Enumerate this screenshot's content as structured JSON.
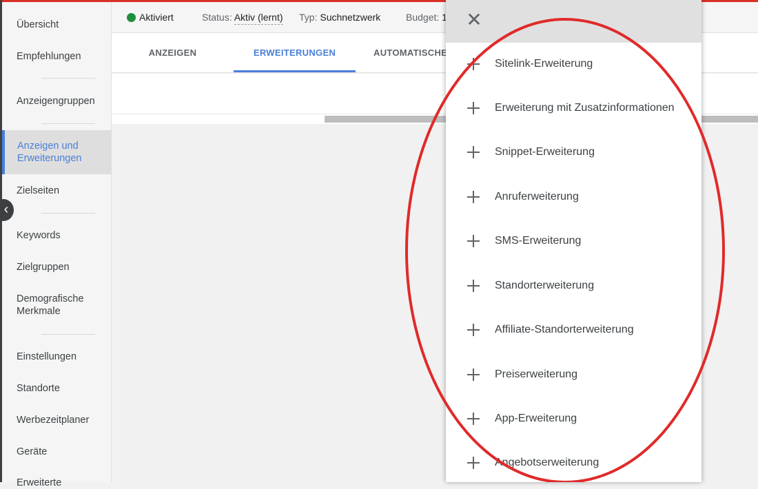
{
  "sidebar": {
    "items": [
      {
        "label": "Übersicht"
      },
      {
        "label": "Empfehlungen"
      },
      {
        "label": "Anzeigengruppen"
      },
      {
        "label": "Anzeigen und Erweiterungen"
      },
      {
        "label": "Zielseiten"
      },
      {
        "label": "Keywords"
      },
      {
        "label": "Zielgruppen"
      },
      {
        "label": "Demografische Merkmale"
      },
      {
        "label": "Einstellungen"
      },
      {
        "label": "Standorte"
      },
      {
        "label": "Werbezeitplaner"
      },
      {
        "label": "Geräte"
      },
      {
        "label": "Erweiterte"
      }
    ],
    "active_item": "Anzeigen und Erweiterungen"
  },
  "header": {
    "state": "Aktiviert",
    "status_label": "Status:",
    "status_value": "Aktiv (lernt)",
    "type_label": "Typ:",
    "type_value": "Suchnetzwerk",
    "budget_label": "Budget:",
    "budget_value": "1"
  },
  "tabs": [
    {
      "label": "ANZEIGEN"
    },
    {
      "label": "ERWEITERUNGEN"
    },
    {
      "label": "AUTOMATISCHE E"
    }
  ],
  "active_tab": "ERWEITERUNGEN",
  "panel": {
    "close_icon": "close-icon",
    "items": [
      {
        "label": "Sitelink-Erweiterung"
      },
      {
        "label": "Erweiterung mit Zusatzinformationen"
      },
      {
        "label": "Snippet-Erweiterung"
      },
      {
        "label": "Anruferweiterung"
      },
      {
        "label": "SMS-Erweiterung"
      },
      {
        "label": "Standorterweiterung"
      },
      {
        "label": "Affiliate-Standorterweiterung"
      },
      {
        "label": "Preiserweiterung"
      },
      {
        "label": "App-Erweiterung"
      },
      {
        "label": "Angebotserweiterung"
      }
    ]
  },
  "colors": {
    "accent": "#4a7fd8",
    "status_green": "#1e8e3e",
    "annotation_red": "#e02a2a",
    "top_bar_red": "#d93025"
  }
}
